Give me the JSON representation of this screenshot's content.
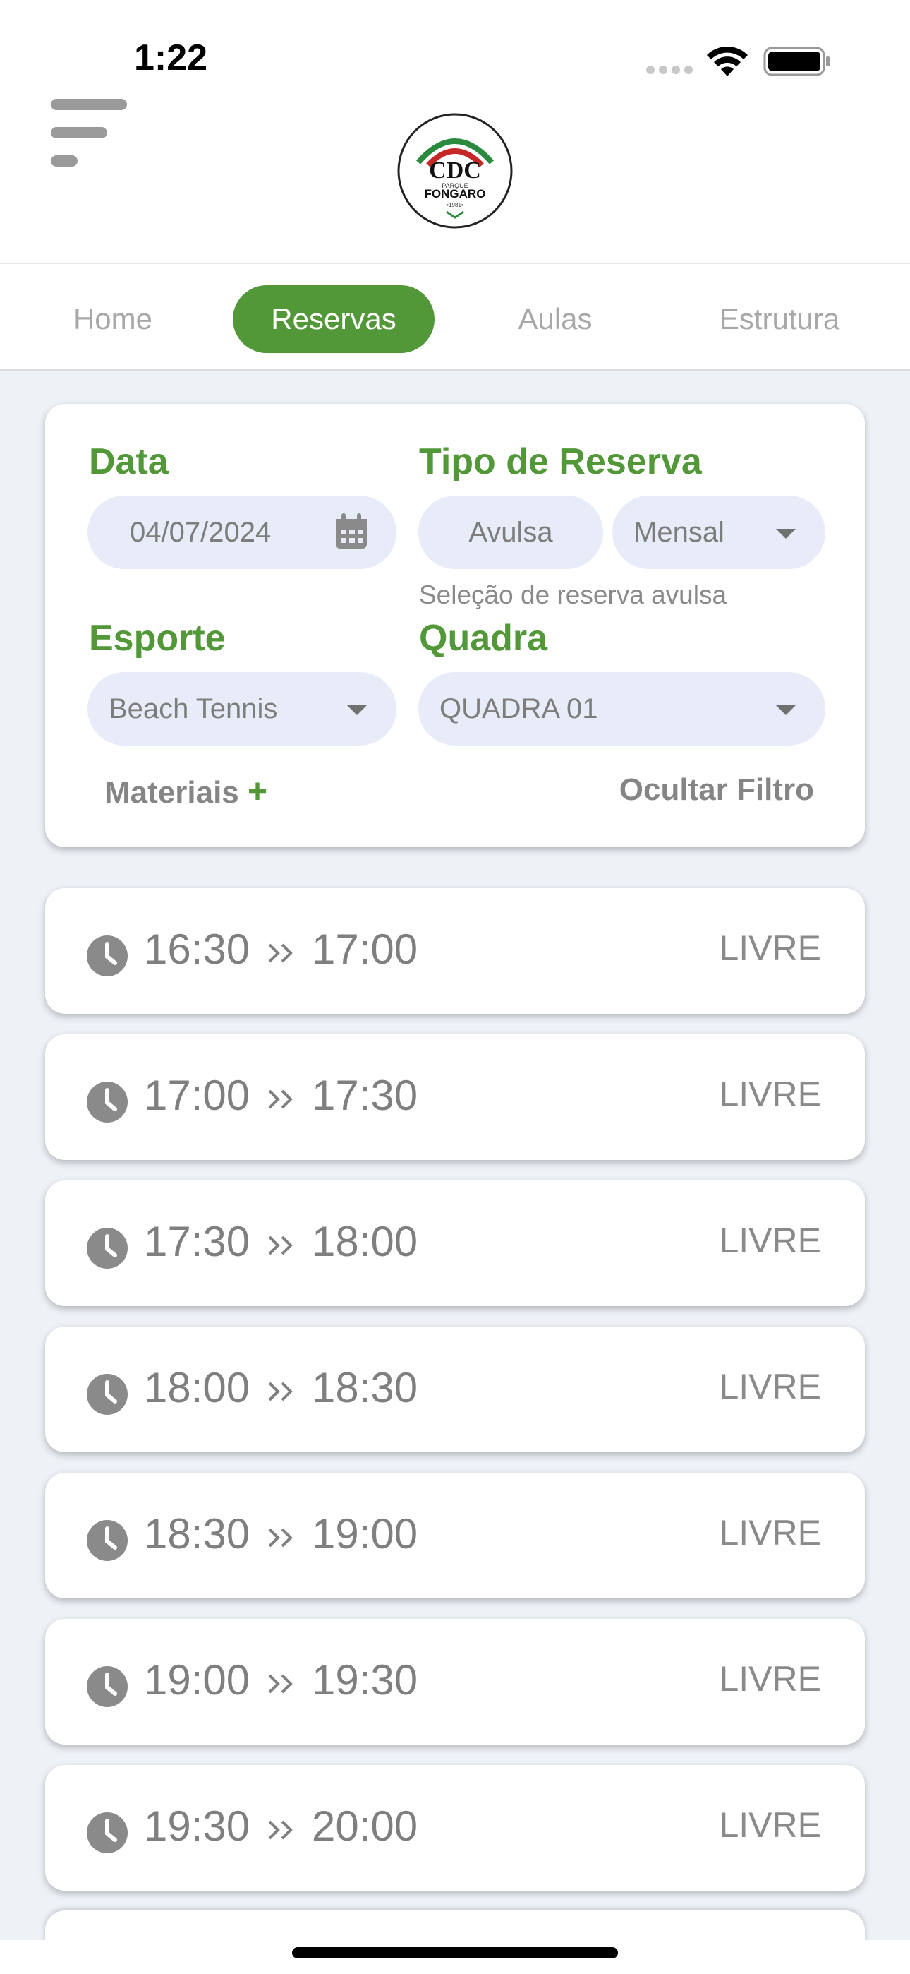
{
  "status_bar": {
    "time": "1:22"
  },
  "header": {
    "logo_text_top": "PARQUE",
    "logo_text": "FONGARO",
    "logo_year": "•1981•"
  },
  "tabs": [
    {
      "label": "Home",
      "active": false
    },
    {
      "label": "Reservas",
      "active": true
    },
    {
      "label": "Aulas",
      "active": false
    },
    {
      "label": "Estrutura",
      "active": false
    }
  ],
  "filter": {
    "date_label": "Data",
    "date_value": "04/07/2024",
    "type_label": "Tipo de Reserva",
    "type_avulsa": "Avulsa",
    "type_mensal": "Mensal",
    "type_hint": "Seleção de reserva avulsa",
    "sport_label": "Esporte",
    "sport_value": "Beach Tennis",
    "court_label": "Quadra",
    "court_value": "QUADRA 01",
    "materials_label": "Materiais",
    "materials_plus": "+",
    "hide_filter_label": "Ocultar Filtro"
  },
  "slots": [
    {
      "start": "16:30",
      "end": "17:00",
      "status": "LIVRE"
    },
    {
      "start": "17:00",
      "end": "17:30",
      "status": "LIVRE"
    },
    {
      "start": "17:30",
      "end": "18:00",
      "status": "LIVRE"
    },
    {
      "start": "18:00",
      "end": "18:30",
      "status": "LIVRE"
    },
    {
      "start": "18:30",
      "end": "19:00",
      "status": "LIVRE"
    },
    {
      "start": "19:00",
      "end": "19:30",
      "status": "LIVRE"
    },
    {
      "start": "19:30",
      "end": "20:00",
      "status": "LIVRE"
    }
  ],
  "colors": {
    "accent_green": "#529838",
    "pill_bg": "#e7ecf8",
    "page_bg": "#eef2f7"
  }
}
